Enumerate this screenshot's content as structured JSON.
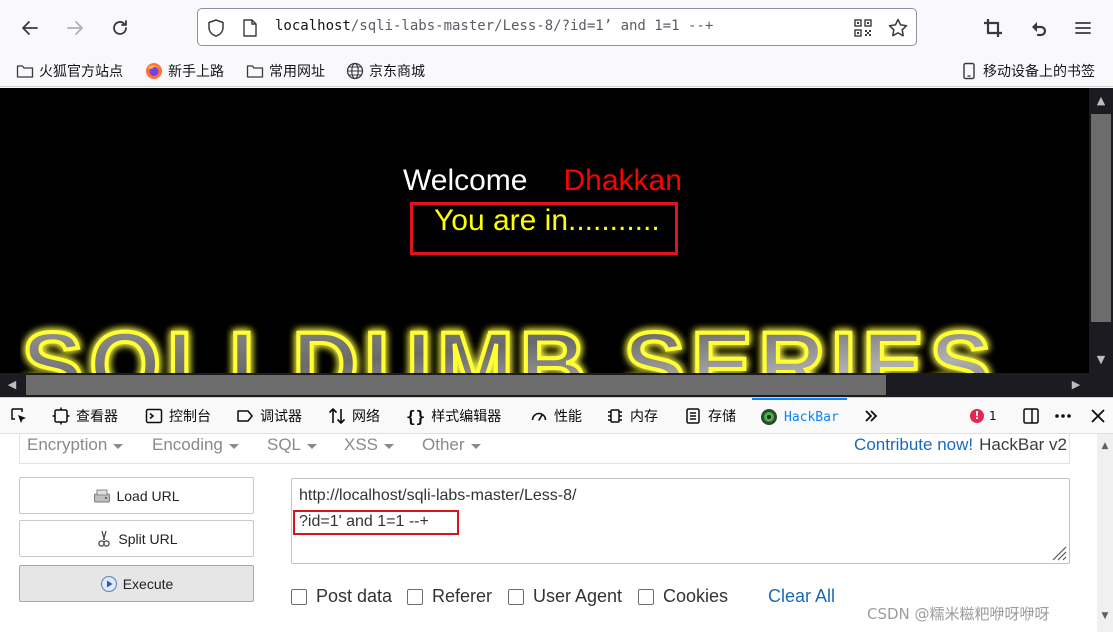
{
  "browser": {
    "url_host": "localhost",
    "url_path": "/sqli-labs-master/Less-8/?id=1’ and 1=1 --+"
  },
  "bookmarks": [
    {
      "label": "火狐官方站点",
      "icon": "folder-icon"
    },
    {
      "label": "新手上路",
      "icon": "firefox-icon"
    },
    {
      "label": "常用网址",
      "icon": "folder-icon"
    },
    {
      "label": "京东商城",
      "icon": "globe-icon"
    }
  ],
  "mobile_bookmarks": "移动设备上的书签",
  "page": {
    "welcome": "Welcome",
    "name": "Dhakkan",
    "message": "You are in...........",
    "banner": "SQLI DUMB SERIES"
  },
  "devtools": {
    "tabs": [
      "查看器",
      "控制台",
      "调试器",
      "网络",
      "样式编辑器",
      "性能",
      "内存",
      "存储",
      "HackBar"
    ],
    "error_count": "1"
  },
  "hackbar": {
    "menus": [
      "Encryption",
      "Encoding",
      "SQL",
      "XSS",
      "Other"
    ],
    "contribute": "Contribute now!",
    "version": "HackBar v2",
    "load_url": "Load URL",
    "split_url": "Split URL",
    "execute": "Execute",
    "url_line1": "http://localhost/sqli-labs-master/Less-8/",
    "url_line2": "?id=1' and 1=1 --+",
    "checkboxes": [
      "Post data",
      "Referer",
      "User Agent",
      "Cookies"
    ],
    "clear_all": "Clear All"
  },
  "watermark": "CSDN @糯米糍粑咿呀咿呀",
  "colors": {
    "accent": "#0a84ff",
    "highlight_border": "#d4161e",
    "welcome_name": "#ff0000",
    "message": "#ffff00"
  }
}
